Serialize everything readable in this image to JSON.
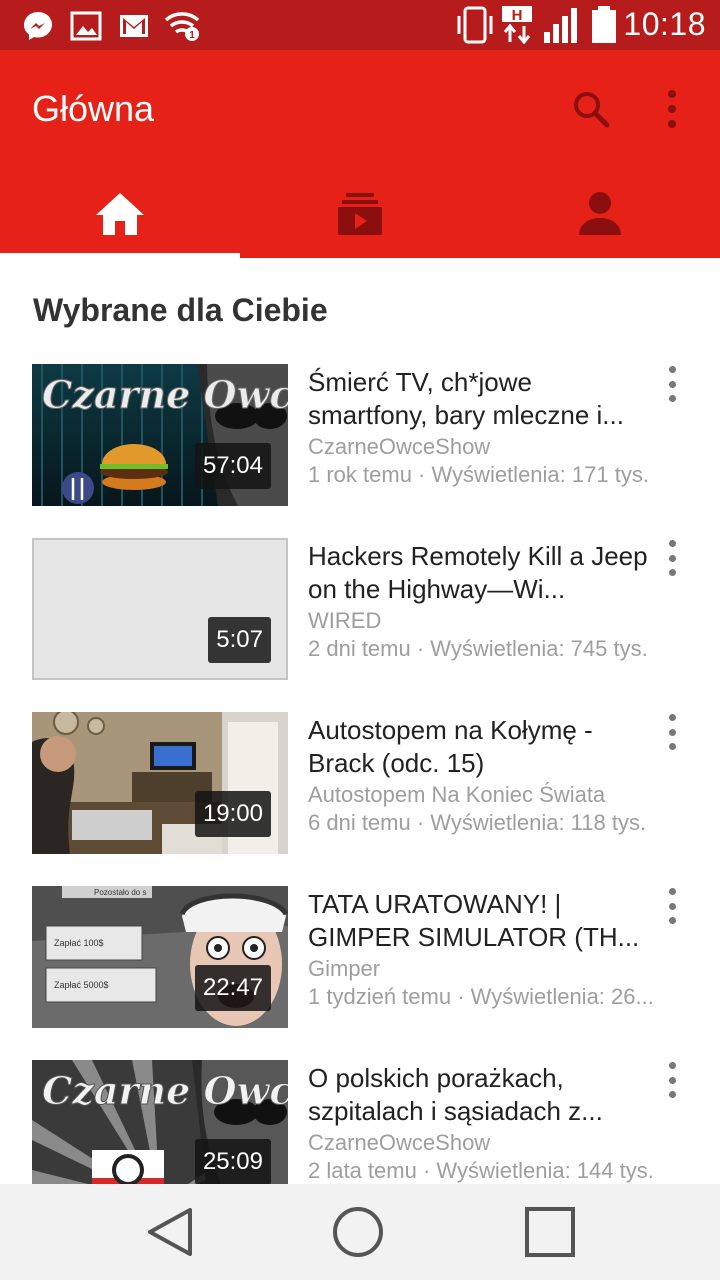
{
  "status_bar": {
    "time": "10:18",
    "network_badge": "H"
  },
  "app_bar": {
    "title": "Główna",
    "tabs": [
      {
        "id": "home",
        "icon": "home-icon",
        "selected": true
      },
      {
        "id": "subscriptions",
        "icon": "subscriptions-icon",
        "selected": false
      },
      {
        "id": "account",
        "icon": "account-icon",
        "selected": false
      }
    ]
  },
  "section": {
    "title": "Wybrane dla Ciebie"
  },
  "videos": [
    {
      "title": "Śmierć TV, ch*jowe smartfony, bary mleczne i...",
      "channel": "CzarneOwceShow",
      "meta": "1 rok temu · Wyświetlenia: 171 tys.",
      "duration": "57:04"
    },
    {
      "title": "Hackers Remotely Kill a Jeep on the Highway—Wi...",
      "channel": "WIRED",
      "meta": "2 dni temu · Wyświetlenia: 745 tys.",
      "duration": "5:07"
    },
    {
      "title": "Autostopem na Kołymę - Brack (odc. 15)",
      "channel": "Autostopem Na Koniec Świata",
      "meta": "6 dni temu · Wyświetlenia: 118 tys.",
      "duration": "19:00"
    },
    {
      "title": "TATA URATOWANY! | GIMPER SIMULATOR (TH...",
      "channel": "Gimper",
      "meta": "1 tydzień temu · Wyświetlenia: 26...",
      "duration": "22:47"
    },
    {
      "title": "O polskich porażkach, szpitalach i sąsiadach z...",
      "channel": "CzarneOwceShow",
      "meta": "2 lata temu · Wyświetlenia: 144 tys.",
      "duration": "25:09"
    }
  ],
  "thumbnails": [
    {
      "text": "Czarne Owce"
    },
    {},
    {},
    {
      "labels": [
        "Zapłać 100$",
        "Zapłać 5000$",
        "Pozostało do s"
      ]
    },
    {
      "text": "Czarne Owce"
    }
  ],
  "colors": {
    "status_bar": "#b71c1c",
    "app_bar": "#e62117",
    "tab_inactive": "#8b0f0f",
    "text_primary": "#222222",
    "text_secondary": "#9e9e9e"
  }
}
